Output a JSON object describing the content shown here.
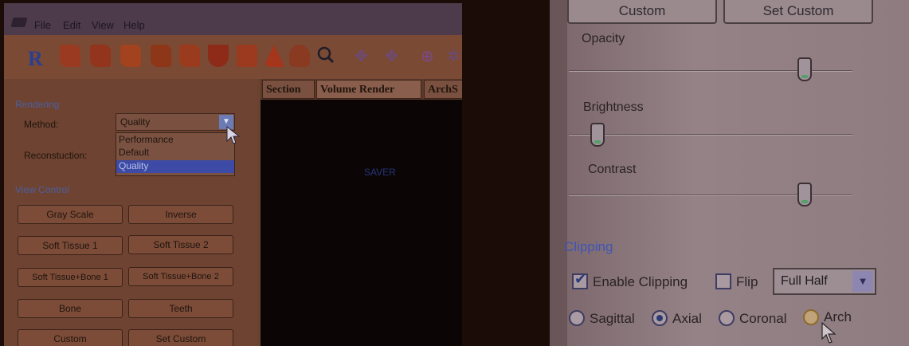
{
  "left": {
    "menu": {
      "items": [
        "File",
        "Edit",
        "View",
        "Help"
      ]
    },
    "toolbar": {
      "logo_letter": "R"
    },
    "rendering": {
      "group_title": "Rendering",
      "method_label": "Method:",
      "method_value": "Quality",
      "reconstruction_label": "Reconstuction:",
      "options": [
        "Performance",
        "Default",
        "Quality"
      ],
      "highlighted_option": "Quality"
    },
    "view_control": {
      "group_title": "View Control",
      "buttons": [
        "Gray Scale",
        "Inverse",
        "Soft Tissue 1",
        "Soft Tissue 2",
        "Soft Tissue+Bone 1",
        "Soft Tissue+Bone 2",
        "Bone",
        "Teeth",
        "Custom",
        "Set Custom"
      ]
    },
    "tabs": [
      "Section",
      "Volume Render",
      "ArchS"
    ],
    "active_tab": "Volume Render",
    "render_view_text": "SAVER"
  },
  "right": {
    "top_buttons": [
      "Custom",
      "Set Custom"
    ],
    "sliders": [
      {
        "label": "Opacity",
        "value_fraction": 0.86
      },
      {
        "label": "Brightness",
        "value_fraction": 0.08
      },
      {
        "label": "Contrast",
        "value_fraction": 0.86
      }
    ],
    "clipping": {
      "group_title": "Clipping",
      "enable_label": "Enable Clipping",
      "enable_checked": true,
      "flip_label": "Flip",
      "flip_checked": false,
      "mode_value": "Full Half",
      "planes": [
        "Sagittal",
        "Axial",
        "Coronal",
        "Arch"
      ],
      "selected_plane": "Axial"
    }
  },
  "colors": {
    "photo_dark": "#1b0c08",
    "left_panel": "#6e4331",
    "right_panel": "#8e7b7f",
    "accent_blue": "#3d4ba6"
  }
}
